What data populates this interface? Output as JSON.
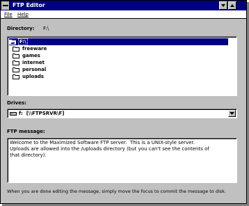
{
  "window": {
    "title": "FTP Editor"
  },
  "menu": {
    "file": "File",
    "help": "Help"
  },
  "directory": {
    "label": "Directory:",
    "value": "F:\\",
    "items": [
      {
        "label": "F:\\",
        "icon": "open-folder-icon",
        "selected": true
      },
      {
        "label": "freeware",
        "icon": "folder-icon"
      },
      {
        "label": "games",
        "icon": "folder-icon"
      },
      {
        "label": "internet",
        "icon": "folder-icon"
      },
      {
        "label": "personal",
        "icon": "folder-icon"
      },
      {
        "label": "uploads",
        "icon": "folder-icon"
      }
    ]
  },
  "drives": {
    "label": "Drives:",
    "selected": "f:  [\\\\FTPSRVR\\F]",
    "icon": "network-drive-icon"
  },
  "message": {
    "label": "FTP message:",
    "text": "Welcome to the Maximized Software FTP server.  This is a UNIX-style server.\nUploads are allowed into the /uploads directory (but you can't see the contents of\nthat directory)."
  },
  "footer": "When you are done editing the message, simply move the focus to commit the message to disk."
}
